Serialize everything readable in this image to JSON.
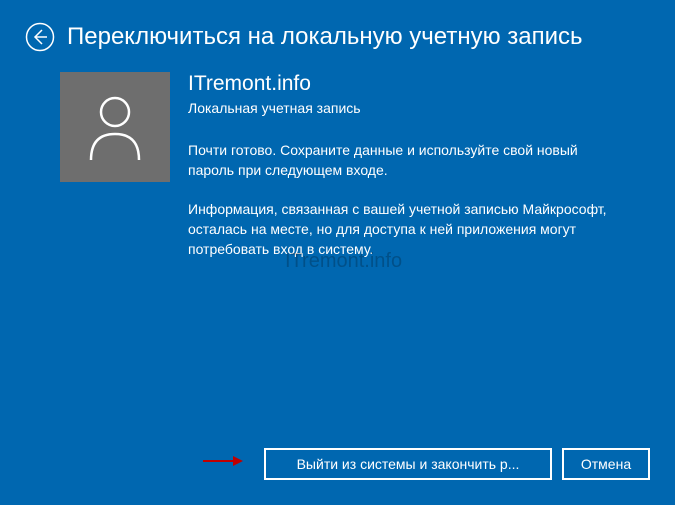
{
  "header": {
    "title": "Переключиться на локальную учетную запись"
  },
  "account": {
    "name": "ITremont.info",
    "type": "Локальная учетная запись"
  },
  "body": {
    "paragraph1": "Почти готово. Сохраните данные и используйте свой новый пароль при следующем входе.",
    "paragraph2": "Информация, связанная с вашей учетной записью Майкрософт, осталась на месте, но для доступа к ней приложения могут потребовать вход в систему."
  },
  "buttons": {
    "primary": "Выйти из системы и закончить р...",
    "cancel": "Отмена"
  },
  "watermark": "ITremont.info"
}
